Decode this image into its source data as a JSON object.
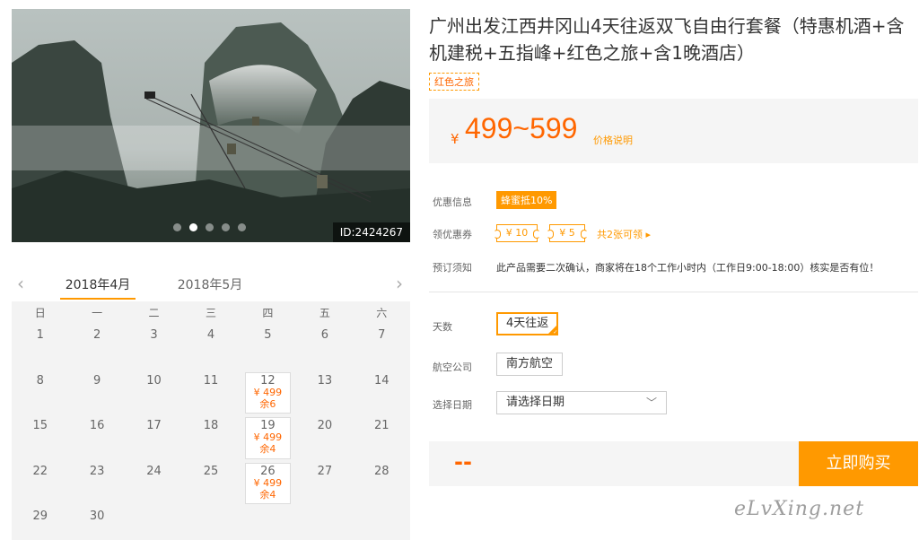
{
  "photo": {
    "id_label": "ID:2424267",
    "slide_count": 5,
    "active_slide": 1
  },
  "calendar": {
    "prev_arrow": "‹",
    "next_arrow": "›",
    "months": [
      {
        "label": "2018年4月",
        "active": true
      },
      {
        "label": "2018年5月",
        "active": false
      }
    ],
    "weekdays": [
      "日",
      "一",
      "二",
      "三",
      "四",
      "五",
      "六"
    ],
    "days": [
      {
        "d": "1"
      },
      {
        "d": "2"
      },
      {
        "d": "3"
      },
      {
        "d": "4"
      },
      {
        "d": "5"
      },
      {
        "d": "6"
      },
      {
        "d": "7"
      },
      {
        "d": "8"
      },
      {
        "d": "9"
      },
      {
        "d": "10"
      },
      {
        "d": "11"
      },
      {
        "d": "12",
        "price": "¥ 499",
        "stock": "余6"
      },
      {
        "d": "13"
      },
      {
        "d": "14"
      },
      {
        "d": "15"
      },
      {
        "d": "16"
      },
      {
        "d": "17"
      },
      {
        "d": "18"
      },
      {
        "d": "19",
        "price": "¥ 499",
        "stock": "余4"
      },
      {
        "d": "20"
      },
      {
        "d": "21"
      },
      {
        "d": "22"
      },
      {
        "d": "23"
      },
      {
        "d": "24"
      },
      {
        "d": "25"
      },
      {
        "d": "26",
        "price": "¥ 499",
        "stock": "余4"
      },
      {
        "d": "27"
      },
      {
        "d": "28"
      },
      {
        "d": "29"
      },
      {
        "d": "30"
      }
    ]
  },
  "product": {
    "title": "广州出发江西井冈山4天往返双飞自由行套餐（特惠机酒+含机建税+五指峰+红色之旅+含1晚酒店）",
    "tag": "红色之旅",
    "currency": "¥",
    "price": "499~599",
    "price_note": "价格说明"
  },
  "promo": {
    "discount_label": "优惠信息",
    "discount_badge": "蜂蜜抵10%",
    "coupon_label": "领优惠券",
    "coupons": [
      "¥ 10",
      "¥ 5"
    ],
    "coupon_more": "共2张可领 ▸",
    "notice_label": "预订须知",
    "notice_text": "此产品需要二次确认，商家将在18个工作小时内（工作日9:00-18:00）核实是否有位！"
  },
  "options": {
    "days_label": "天数",
    "days_value": "4天往返",
    "airline_label": "航空公司",
    "airline_value": "南方航空",
    "date_label": "选择日期",
    "date_placeholder": "请选择日期"
  },
  "buy": {
    "total": "--",
    "button": "立即购买"
  },
  "watermark": "eLvXing.net",
  "colors": {
    "accent": "#ff9900",
    "price": "#ff6600"
  }
}
